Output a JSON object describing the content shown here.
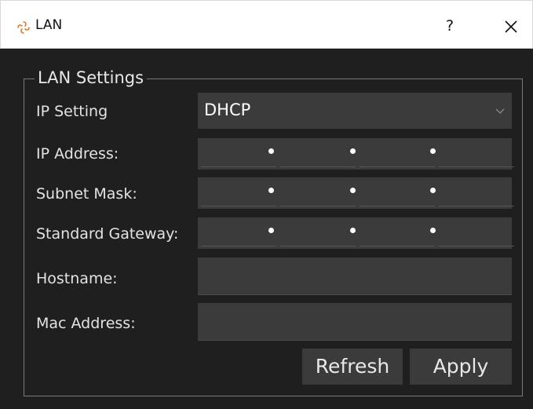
{
  "window": {
    "title": "LAN",
    "help_label": "?",
    "icon": "app-logo-icon",
    "close_icon": "close-icon"
  },
  "group": {
    "title": "LAN Settings"
  },
  "form": {
    "ip_setting": {
      "label": "IP Setting",
      "value": "DHCP"
    },
    "ip_address": {
      "label": "IP Address:",
      "octets": [
        "",
        "",
        "",
        ""
      ]
    },
    "subnet_mask": {
      "label": "Subnet Mask:",
      "octets": [
        "",
        "",
        "",
        ""
      ]
    },
    "gateway": {
      "label": "Standard Gateway:",
      "octets": [
        "",
        "",
        "",
        ""
      ]
    },
    "hostname": {
      "label": "Hostname:",
      "value": ""
    },
    "mac": {
      "label": "Mac Address:",
      "value": ""
    }
  },
  "buttons": {
    "refresh": "Refresh",
    "apply": "Apply"
  },
  "colors": {
    "background": "#1f1f1f",
    "field": "#3b3b3b",
    "text": "#e3e3e3"
  }
}
